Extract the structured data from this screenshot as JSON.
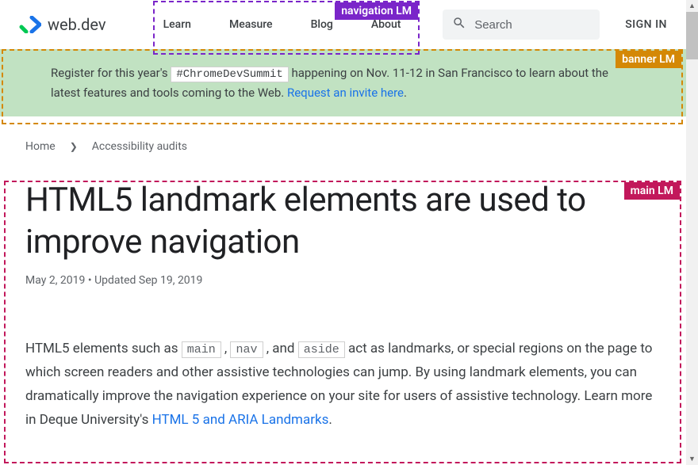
{
  "header": {
    "logo_text": "web.dev",
    "nav": [
      "Learn",
      "Measure",
      "Blog",
      "About"
    ],
    "search_placeholder": "Search",
    "signin_label": "SIGN IN"
  },
  "banner": {
    "text_before": "Register for this year's ",
    "hashtag": "#ChromeDevSummit",
    "text_mid": " happening on Nov. 11-12 in San Francisco to learn about the latest features and tools coming to the Web. ",
    "link_text": "Request an invite here",
    "period": "."
  },
  "breadcrumbs": {
    "items": [
      "Home",
      "Accessibility audits"
    ]
  },
  "page": {
    "title": "HTML5 landmark elements are used to improve navigation",
    "published": "May 2, 2019",
    "updated_prefix": "Updated ",
    "updated": "Sep 19, 2019",
    "meta_sep": "  •  "
  },
  "article": {
    "p1_a": "HTML5 elements such as ",
    "code1": "main",
    "sep1": " , ",
    "code2": "nav",
    "sep2": " , and ",
    "code3": "aside",
    "p1_b": " act as landmarks, or special regions on the page to which screen readers and other assistive technologies can jump. By using landmark elements, you can dramatically improve the navigation experience on your site for users of assistive technology. Learn more in Deque University's ",
    "link1": "HTML 5 and ARIA Landmarks",
    "p1_c": "."
  },
  "landmarks": {
    "nav_label": "navigation LM",
    "banner_label": "banner LM",
    "main_label": "main LM"
  }
}
